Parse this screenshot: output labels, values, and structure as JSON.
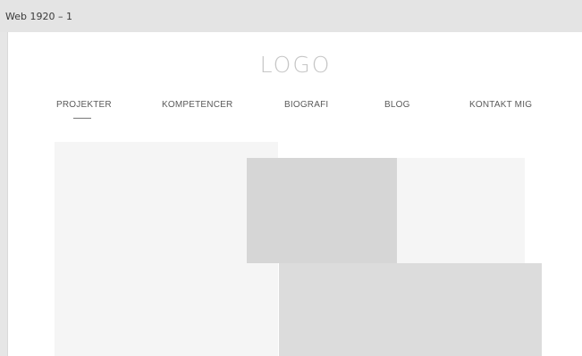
{
  "window": {
    "title": "Web 1920 – 1"
  },
  "header": {
    "logo": "LOGO"
  },
  "nav": {
    "items": [
      {
        "label": "PROJEKTER",
        "active": true
      },
      {
        "label": "KOMPETENCER",
        "active": false
      },
      {
        "label": "BIOGRAFI",
        "active": false
      },
      {
        "label": "BLOG",
        "active": false
      },
      {
        "label": "KONTAKT MIG",
        "active": false
      }
    ]
  },
  "colors": {
    "canvas_background": "#e6e6e6",
    "artboard_background": "#ffffff",
    "logo_text": "#c6c6c6",
    "nav_text": "#5a5a5a",
    "block_light": "#f5f5f5",
    "block_medium": "#d6d6d6",
    "block_lighter_gray": "#dcdcdc"
  }
}
